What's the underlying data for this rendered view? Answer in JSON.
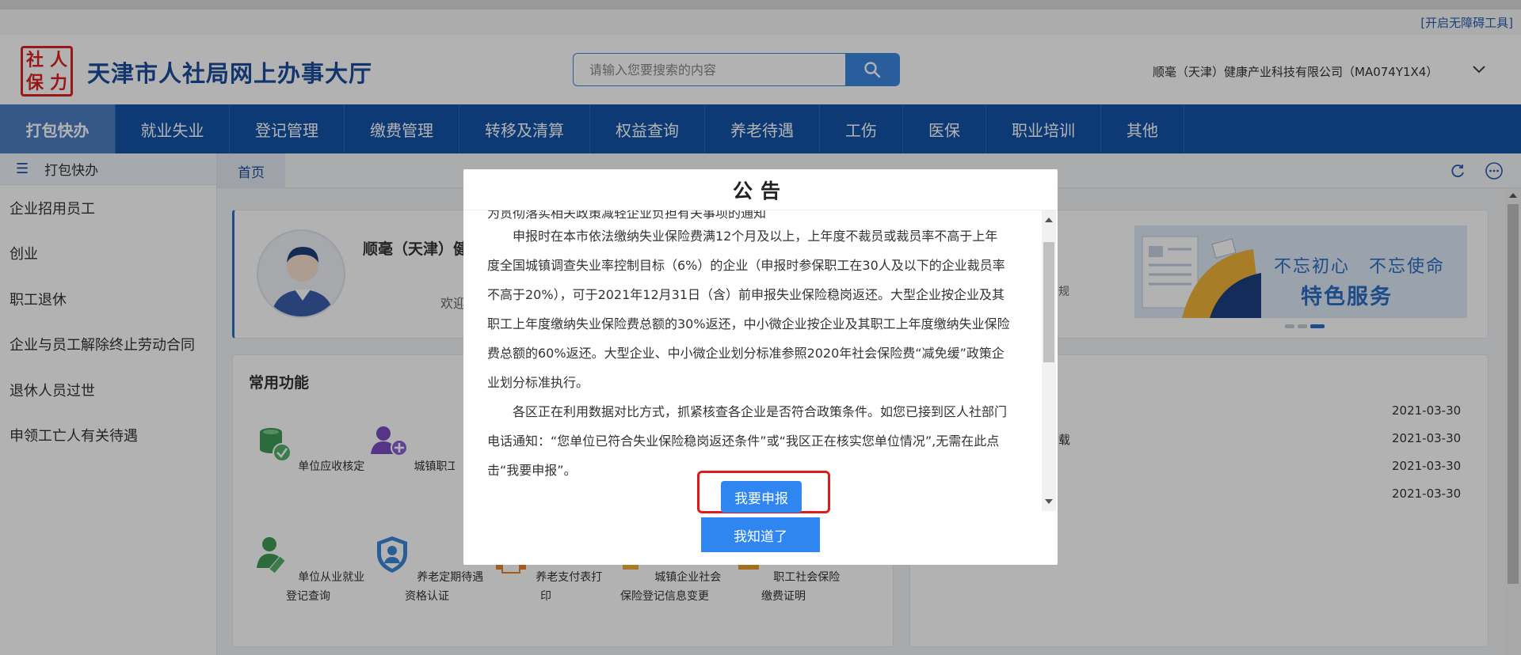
{
  "accessibility_link": "[开启无障碍工具]",
  "header": {
    "logo_chars": [
      "社",
      "人",
      "保",
      "力"
    ],
    "site_title": "天津市人社局网上办事大厅",
    "search_placeholder": "请输入您要搜索的内容",
    "company_name": "顺毫（天津）健康产业科技有限公司（MA074Y1X4）"
  },
  "nav": {
    "items": [
      "打包快办",
      "就业失业",
      "登记管理",
      "缴费管理",
      "转移及清算",
      "权益查询",
      "养老待遇",
      "工伤",
      "医保",
      "职业培训",
      "其他"
    ],
    "active_index": 0
  },
  "sidebar": {
    "title": "打包快办",
    "items": [
      "企业招用员工",
      "创业",
      "职工退休",
      "企业与员工解除终止劳动合同",
      "退休人员过世",
      "申领工亡人有关待遇"
    ]
  },
  "tabs": {
    "home": "首页"
  },
  "user_card": {
    "name": "顺毫（天津）健",
    "welcome": "欢迎",
    "side_text": "规"
  },
  "banner": {
    "line1": "不忘初心　不忘使命",
    "line2": "特色服务",
    "colors": {
      "accent": "#2a6dc4",
      "bg": "#dde9f7"
    }
  },
  "common_functions": {
    "title": "常用功能",
    "items": [
      {
        "label": "单位应收核定",
        "icon": "coin-check-icon"
      },
      {
        "label": "城镇职工增加",
        "icon": "user-add-icon"
      },
      {
        "label": "单位从业就业登记查询",
        "icon": "user-edit-icon"
      },
      {
        "label": "养老定期待遇资格认证",
        "icon": "shield-user-icon"
      },
      {
        "label": "养老支付表打印",
        "icon": "printer-icon"
      },
      {
        "label": "城镇企业社会保险登记信息变更",
        "icon": "edit-doc-icon"
      },
      {
        "label": "职工社会保险缴费证明",
        "icon": "certificate-icon"
      }
    ]
  },
  "news": {
    "fragment": "载",
    "dates": [
      "2021-03-30",
      "2021-03-30",
      "2021-03-30",
      "2021-03-30"
    ]
  },
  "modal": {
    "title": "公告",
    "clipped_line": "为贯彻落实相关政策减轻企业负担有关事项的通知",
    "paragraphs": [
      "申报时在本市依法缴纳失业保险费满12个月及以上，上年度不裁员或裁员率不高于上年度全国城镇调查失业率控制目标（6%）的企业（申报时参保职工在30人及以下的企业裁员率不高于20%），可于2021年12月31日（含）前申报失业保险稳岗返还。大型企业按企业及其职工上年度缴纳失业保险费总额的30%返还，中小微企业按企业及其职工上年度缴纳失业保险费总额的60%返还。大型企业、中小微企业划分标准参照2020年社会保险费“减免缓”政策企业划分标准执行。",
      "各区正在利用数据对比方式，抓紧核查各企业是否符合政策条件。如您已接到区人社部门电话通知：“您单位已符合失业保险稳岗返还条件”或“我区正在核实您单位情况”,无需在此点击“我要申报”。"
    ],
    "apply_button": "我要申报",
    "ok_button": "我知道了",
    "colors": {
      "button": "#2f86f0",
      "highlight": "#e11b1b"
    }
  }
}
